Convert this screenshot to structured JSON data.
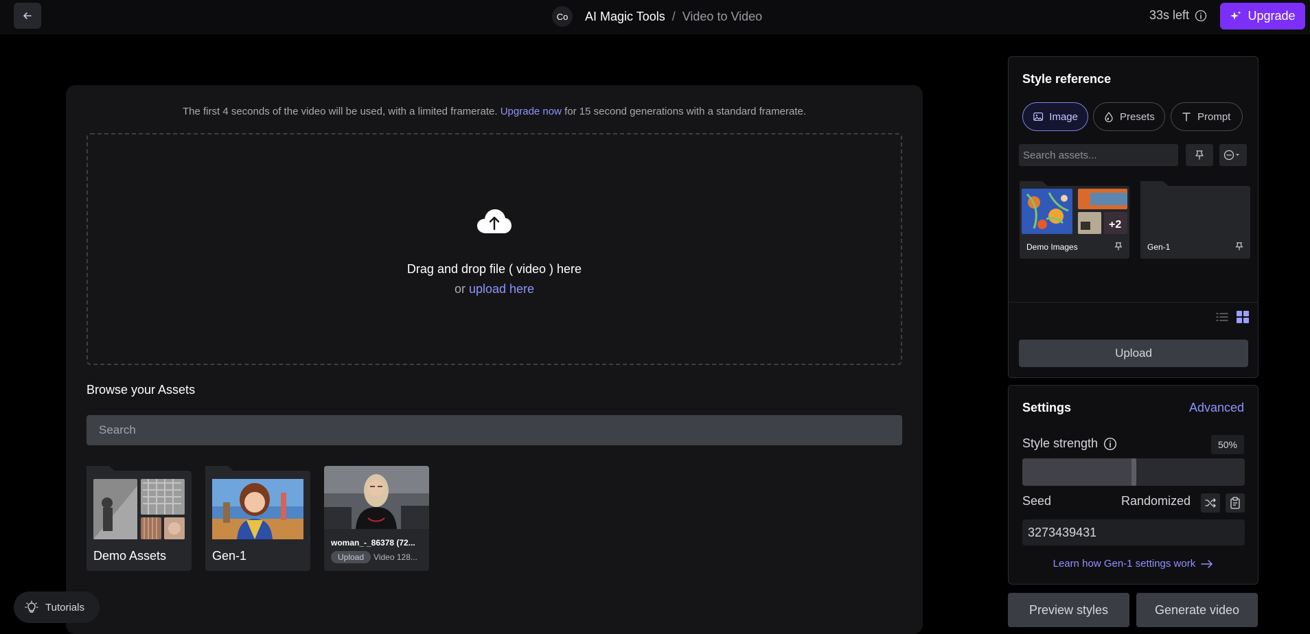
{
  "header": {
    "back_icon": "arrow-left-icon",
    "badge": "Co",
    "app_name": "AI Magic Tools",
    "separator": "/",
    "tool_name": "Video to Video",
    "time_left": "33s left",
    "info_icon": "info-icon",
    "upgrade_label": "Upgrade",
    "upgrade_color": "#7b2ff7"
  },
  "main": {
    "notice_prefix": "The first 4 seconds of the video will be used, with a limited framerate.",
    "notice_link": "Upgrade now",
    "notice_suffix": "for 15 second generations with a standard framerate.",
    "dropzone_title": "Drag and drop file ( video ) here",
    "dropzone_or": "or",
    "dropzone_link": "upload here",
    "browse_title": "Browse your Assets",
    "search_placeholder": "Search",
    "assets": [
      {
        "label": "Demo Assets"
      },
      {
        "label": "Gen-1"
      }
    ],
    "video": {
      "name": "woman_-_86378 (72...",
      "badge": "Upload",
      "meta": "Video 128..."
    }
  },
  "tutorials_label": "Tutorials",
  "style_reference": {
    "title": "Style reference",
    "tabs": [
      {
        "label": "Image",
        "icon": "image-icon",
        "active": true
      },
      {
        "label": "Presets",
        "icon": "drop-icon",
        "active": false
      },
      {
        "label": "Prompt",
        "icon": "text-icon",
        "active": false
      }
    ],
    "search_placeholder": "Search assets...",
    "folders": [
      {
        "name": "Demo Images",
        "extra": "+2"
      },
      {
        "name": "Gen-1"
      }
    ],
    "upload_label": "Upload"
  },
  "settings": {
    "title": "Settings",
    "advanced_label": "Advanced",
    "style_strength_label": "Style strength",
    "style_strength_value": "50%",
    "style_strength_fraction": 0.5,
    "seed_label": "Seed",
    "randomized_label": "Randomized",
    "seed_value": "3273439431",
    "learn_link": "Learn how Gen-1 settings work"
  },
  "actions": {
    "preview_label": "Preview styles",
    "generate_label": "Generate video"
  },
  "accent_color": "#8f92ff"
}
